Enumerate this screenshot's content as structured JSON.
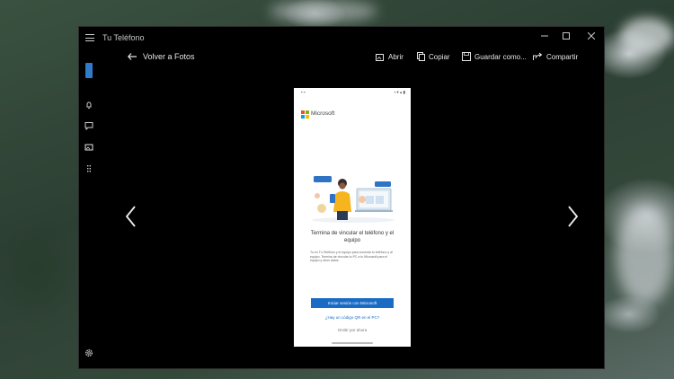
{
  "window": {
    "title": "Tu Teléfono"
  },
  "toolbar": {
    "back_label": "Volver a Fotos",
    "open_label": "Abrir",
    "copy_label": "Copiar",
    "save_as_label": "Guardar como...",
    "share_label": "Compartir"
  },
  "sidebar": {
    "items": [
      {
        "icon": "phone-icon"
      },
      {
        "icon": "notification-icon"
      },
      {
        "icon": "messages-icon"
      },
      {
        "icon": "photos-icon"
      },
      {
        "icon": "apps-icon"
      },
      {
        "icon": "settings-icon"
      }
    ]
  },
  "photo": {
    "brand": "Microsoft",
    "title_line1": "Termina de vincular el teléfono y el",
    "title_line2": "equipo",
    "body_text": "Tu en Tu Teléfono y el equipo para conectar tu teléfono y al equipo. Termina de vincular tu PC a tu Microsoft para el equipo y otros datos.",
    "button_label": "Iniciar sesión con Microsoft",
    "link_label": "¿Hay un código QR en el PC?",
    "secondary_label": "Omitir por ahora"
  },
  "colors": {
    "accent": "#2f7bc9",
    "button": "#1a6bc4",
    "background": "#000000"
  }
}
